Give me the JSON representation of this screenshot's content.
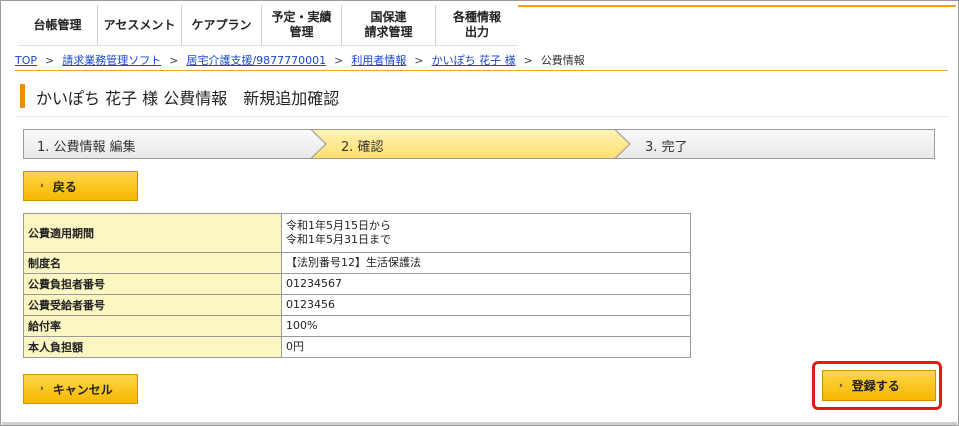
{
  "nav": {
    "tabs": [
      {
        "label": "台帳管理"
      },
      {
        "label": "アセスメント"
      },
      {
        "label": "ケアプラン"
      },
      {
        "label": "予定・実績\n管理"
      },
      {
        "label": "国保連\n請求管理"
      },
      {
        "label": "各種情報\n出力"
      }
    ]
  },
  "breadcrumb": {
    "items": [
      "TOP",
      "請求業務管理ソフト",
      "居宅介護支援/9877770001",
      "利用者情報",
      "かいぽち 花子 様"
    ],
    "current": "公費情報",
    "separator": ">"
  },
  "page_title": "かいぽち 花子 様 公費情報　新規追加確認",
  "steps": [
    {
      "label": "1. 公費情報 編集",
      "active": false
    },
    {
      "label": "2. 確認",
      "active": true
    },
    {
      "label": "3. 完了",
      "active": false
    }
  ],
  "buttons": {
    "back": "戻る",
    "cancel": "キャンセル",
    "register": "登録する"
  },
  "table": {
    "rows": [
      {
        "key": "公費適用期間",
        "value": "令和1年5月15日から",
        "value2": "令和1年5月31日まで"
      },
      {
        "key": "制度名",
        "value": "【法別番号12】生活保護法"
      },
      {
        "key": "公費負担者番号",
        "value": "01234567"
      },
      {
        "key": "公費受給者番号",
        "value": "0123456"
      },
      {
        "key": "給付率",
        "value": "100%"
      },
      {
        "key": "本人負担額",
        "value": "0円"
      }
    ]
  },
  "colors": {
    "accent": "#f08c00",
    "button": "#f6b800",
    "step_active": "#ffe483",
    "highlight": "#e21a1a",
    "link": "#1a49c8"
  }
}
